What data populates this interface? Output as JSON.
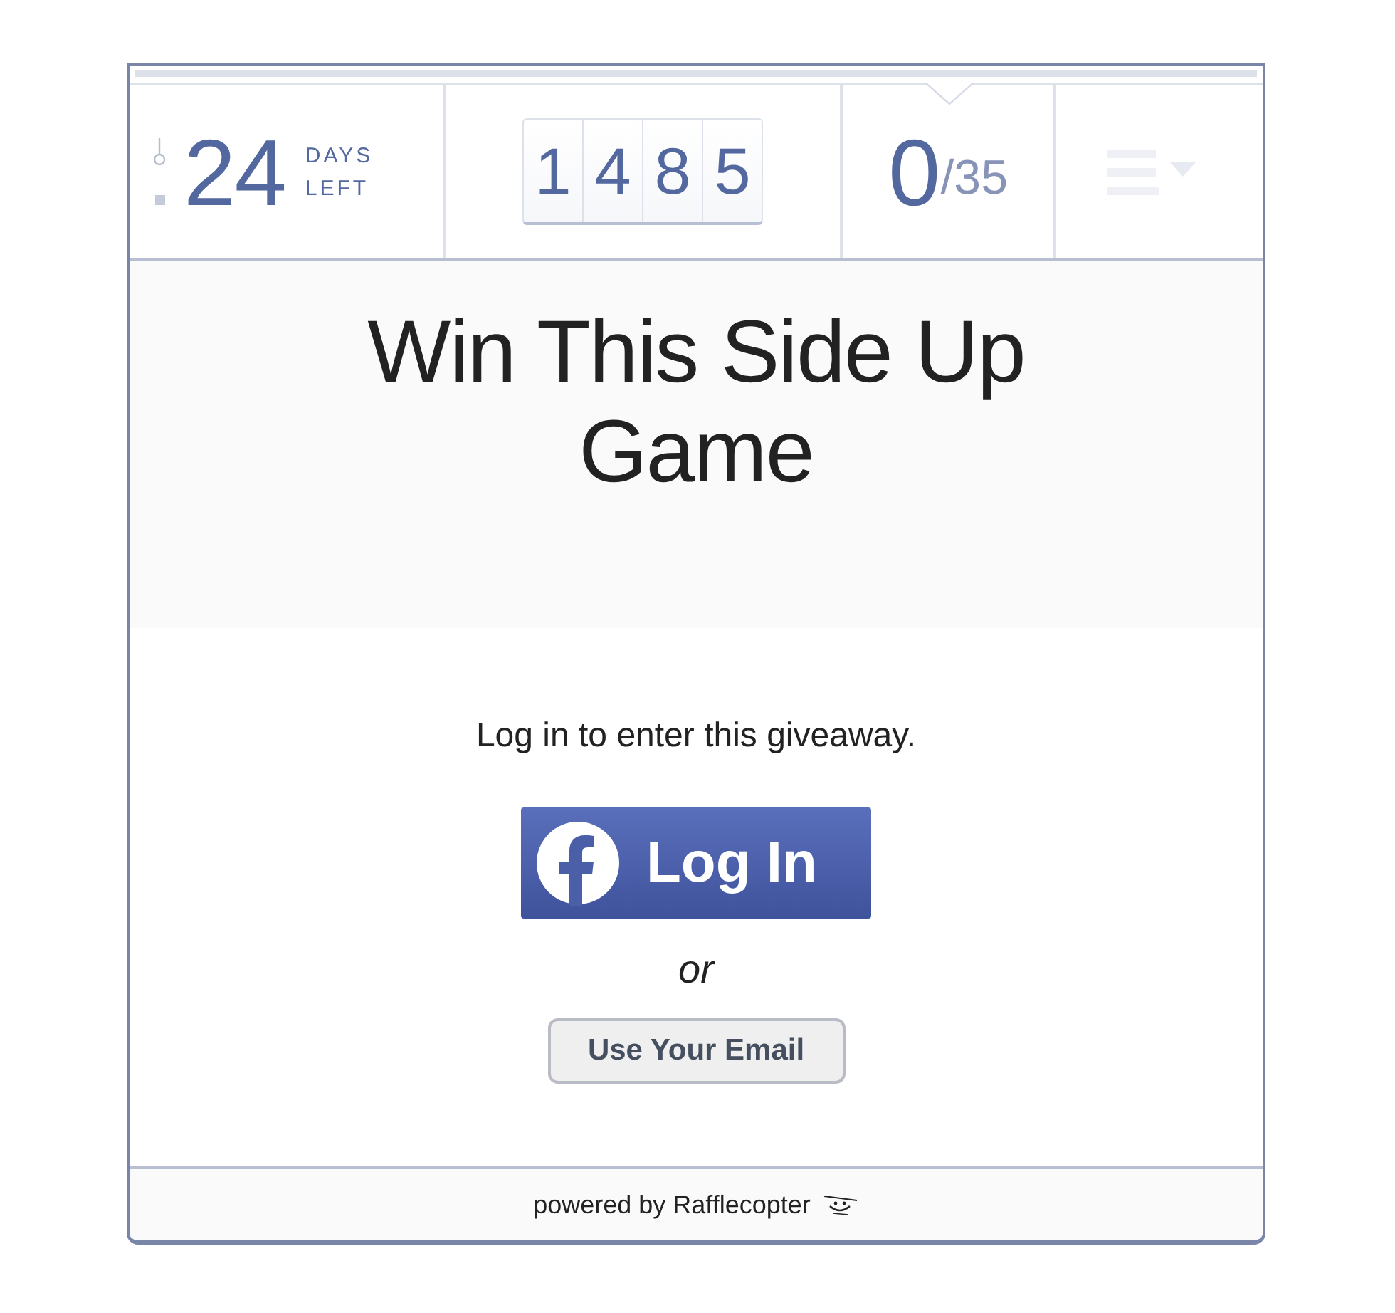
{
  "stats": {
    "days": "24",
    "days_label": [
      "DAYS",
      "LEFT"
    ],
    "entry_digits": [
      "1",
      "4",
      "8",
      "5"
    ],
    "your_entries": "0",
    "total_entries": "/35"
  },
  "title": "Win This Side Up Game",
  "login": {
    "prompt": "Log in to enter this giveaway.",
    "facebook_button": "Log In",
    "separator": "or",
    "email_button": "Use Your Email"
  },
  "footer": "powered by Rafflecopter"
}
